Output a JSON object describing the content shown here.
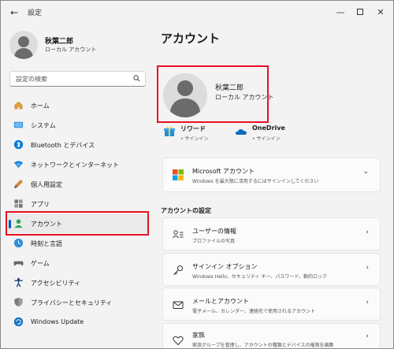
{
  "window": {
    "title": "設定",
    "back": "←",
    "minimize": "—",
    "close": "✕"
  },
  "profile": {
    "name": "秋葉二郎",
    "account_type": "ローカル アカウント"
  },
  "search": {
    "placeholder": "設定の検索"
  },
  "nav": [
    {
      "label": "ホーム",
      "icon": "home-icon"
    },
    {
      "label": "システム",
      "icon": "system-icon"
    },
    {
      "label": "Bluetooth とデバイス",
      "icon": "bluetooth-icon"
    },
    {
      "label": "ネットワークとインターネット",
      "icon": "network-icon"
    },
    {
      "label": "個人用設定",
      "icon": "personalization-icon"
    },
    {
      "label": "アプリ",
      "icon": "apps-icon"
    },
    {
      "label": "アカウント",
      "icon": "accounts-icon",
      "active": true
    },
    {
      "label": "時刻と言語",
      "icon": "time-language-icon"
    },
    {
      "label": "ゲーム",
      "icon": "gaming-icon"
    },
    {
      "label": "アクセシビリティ",
      "icon": "accessibility-icon"
    },
    {
      "label": "プライバシーとセキュリティ",
      "icon": "privacy-icon"
    },
    {
      "label": "Windows Update",
      "icon": "windows-update-icon"
    }
  ],
  "main": {
    "title": "アカウント",
    "account_name": "秋葉二郎",
    "account_type": "ローカル アカウント",
    "services": [
      {
        "name": "リワード",
        "status": "• サインイン",
        "icon": "rewards-icon"
      },
      {
        "name": "OneDrive",
        "status": "• サインイン",
        "icon": "onedrive-icon"
      }
    ],
    "ms_account": {
      "title": "Microsoft アカウント",
      "subtitle": "Windows を最大限に活用するにはサインインしてください",
      "chevron": "⌄"
    },
    "section_title": "アカウントの設定",
    "settings": [
      {
        "title": "ユーザーの情報",
        "subtitle": "プロファイルの写真",
        "icon": "user-info-icon"
      },
      {
        "title": "サインイン オプション",
        "subtitle": "Windows Hello、セキュリティ キー、パスワード、動的ロック",
        "icon": "key-icon"
      },
      {
        "title": "メールとアカウント",
        "subtitle": "電子メール、カレンダー、連絡先で使用されるアカウント",
        "icon": "mail-icon"
      },
      {
        "title": "家族",
        "subtitle": "家族グループを管理し、アカウントの種類とデバイスの権限を編集",
        "icon": "family-icon"
      }
    ],
    "chevron": "›"
  },
  "colors": {
    "accent": "#005fb8",
    "highlight": "#e81123"
  }
}
